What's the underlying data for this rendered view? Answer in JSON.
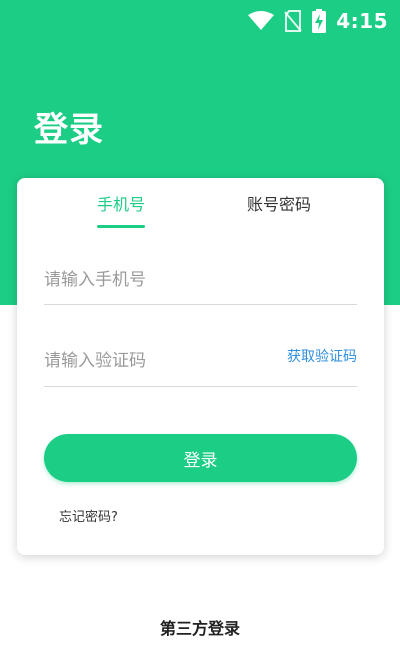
{
  "status_bar": {
    "time": "4:15",
    "icons": [
      "wifi-icon",
      "no-sim-icon",
      "battery-charging-icon"
    ]
  },
  "header": {
    "title": "登录"
  },
  "tabs": [
    {
      "label": "手机号",
      "active": true
    },
    {
      "label": "账号密码",
      "active": false
    }
  ],
  "form": {
    "phone_placeholder": "请输入手机号",
    "code_placeholder": "请输入验证码",
    "get_code_label": "获取验证码",
    "login_label": "登录",
    "forgot_label": "忘记密码?"
  },
  "footer": {
    "third_party_label": "第三方登录"
  },
  "colors": {
    "accent": "#1ccd86",
    "link": "#2f8fe0"
  }
}
